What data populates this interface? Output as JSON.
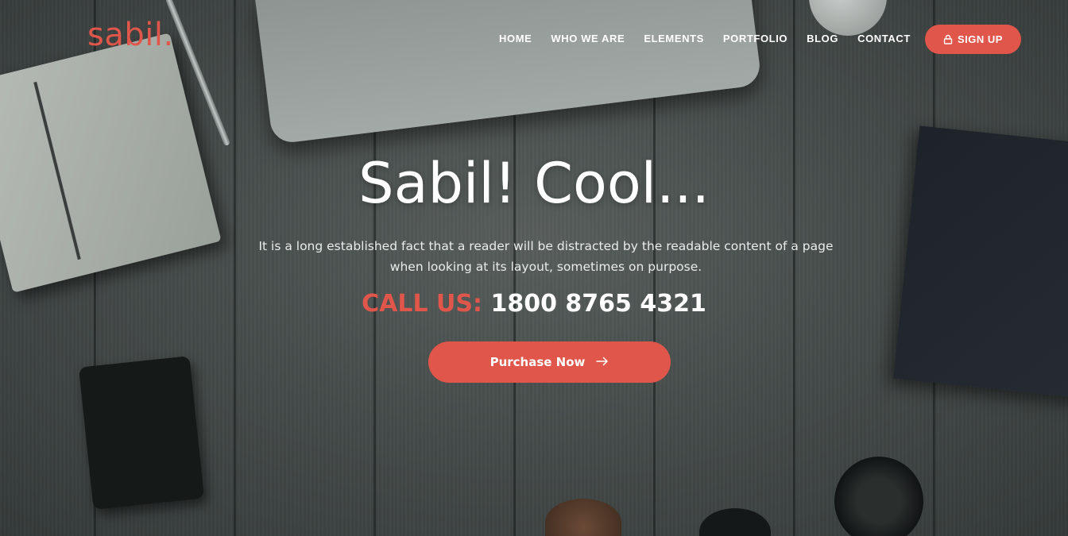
{
  "brand": {
    "logo_text": "sabil.",
    "accent_color": "#e0564a"
  },
  "nav": {
    "items": [
      {
        "label": "HOME"
      },
      {
        "label": "WHO WE ARE"
      },
      {
        "label": "ELEMENTS"
      },
      {
        "label": "PORTFOLIO"
      },
      {
        "label": "BLOG"
      },
      {
        "label": "CONTACT"
      }
    ],
    "signup": {
      "icon": "lock-icon",
      "label": "SIGN UP"
    }
  },
  "hero": {
    "title": "Sabil! Cool...",
    "description": "It is a long established fact that a reader will be distracted by the readable content of a page when looking at its layout, sometimes on purpose.",
    "call_label": "CALL US:",
    "call_number": "1800 8765 4321",
    "cta": {
      "label": "Purchase Now",
      "icon": "arrow-right-icon"
    }
  }
}
